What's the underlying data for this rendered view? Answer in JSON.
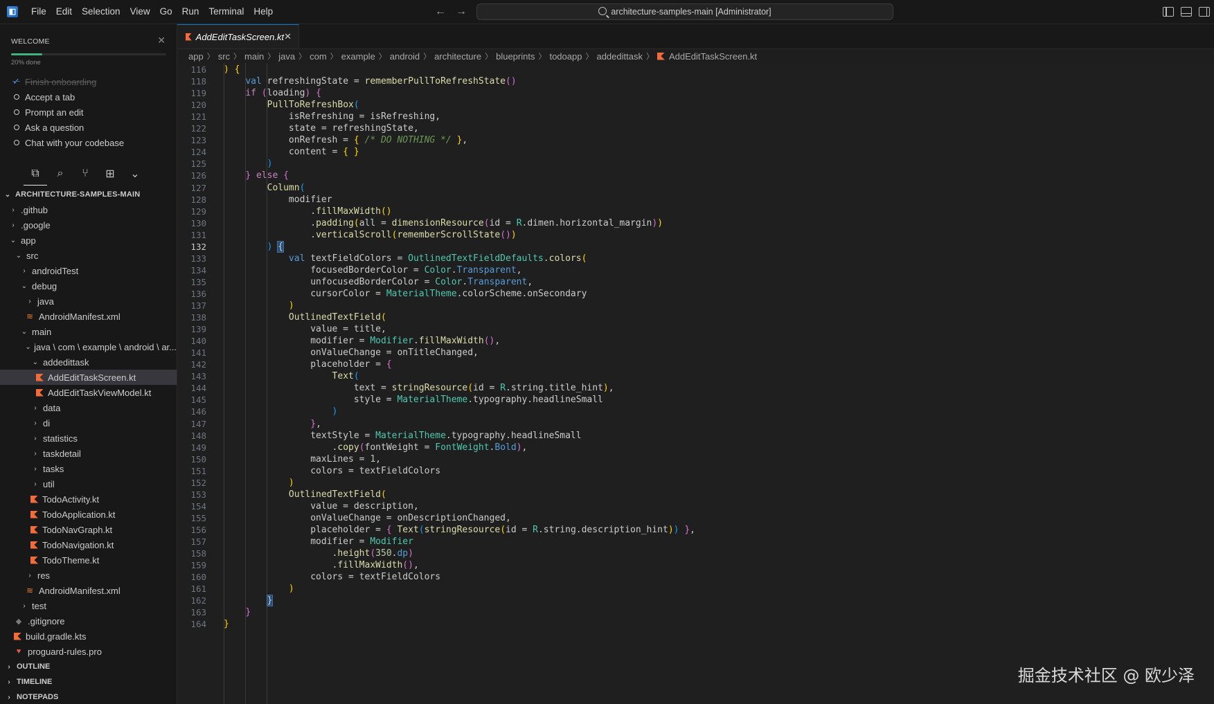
{
  "titlebar": {
    "menu": [
      "File",
      "Edit",
      "Selection",
      "View",
      "Go",
      "Run",
      "Terminal",
      "Help"
    ],
    "search_text": "architecture-samples-main [Administrator]"
  },
  "welcome": {
    "title": "WELCOME",
    "progress_fraction": 0.2,
    "progress_text": "20% done",
    "items": [
      {
        "label": "Finish onboarding",
        "done": true
      },
      {
        "label": "Accept a tab",
        "done": false
      },
      {
        "label": "Prompt an edit",
        "done": false
      },
      {
        "label": "Ask a question",
        "done": false
      },
      {
        "label": "Chat with your codebase",
        "done": false
      }
    ]
  },
  "explorer": {
    "root": "ARCHITECTURE-SAMPLES-MAIN",
    "tree": [
      {
        "label": ".github",
        "depth": 1,
        "type": "folder",
        "open": false
      },
      {
        "label": ".google",
        "depth": 1,
        "type": "folder",
        "open": false
      },
      {
        "label": "app",
        "depth": 1,
        "type": "folder",
        "open": true
      },
      {
        "label": "src",
        "depth": 2,
        "type": "folder",
        "open": true
      },
      {
        "label": "androidTest",
        "depth": 3,
        "type": "folder",
        "open": false
      },
      {
        "label": "debug",
        "depth": 3,
        "type": "folder",
        "open": true
      },
      {
        "label": "java",
        "depth": 4,
        "type": "folder",
        "open": false
      },
      {
        "label": "AndroidManifest.xml",
        "depth": 4,
        "type": "xml"
      },
      {
        "label": "main",
        "depth": 3,
        "type": "folder",
        "open": true
      },
      {
        "label": "java \\ com \\ example \\ android \\ ar...",
        "depth": 4,
        "type": "folder",
        "open": true
      },
      {
        "label": "addedittask",
        "depth": 5,
        "type": "folder",
        "open": true
      },
      {
        "label": "AddEditTaskScreen.kt",
        "depth": 6,
        "type": "kt",
        "selected": true
      },
      {
        "label": "AddEditTaskViewModel.kt",
        "depth": 6,
        "type": "kt"
      },
      {
        "label": "data",
        "depth": 5,
        "type": "folder",
        "open": false
      },
      {
        "label": "di",
        "depth": 5,
        "type": "folder",
        "open": false
      },
      {
        "label": "statistics",
        "depth": 5,
        "type": "folder",
        "open": false
      },
      {
        "label": "taskdetail",
        "depth": 5,
        "type": "folder",
        "open": false
      },
      {
        "label": "tasks",
        "depth": 5,
        "type": "folder",
        "open": false
      },
      {
        "label": "util",
        "depth": 5,
        "type": "folder",
        "open": false
      },
      {
        "label": "TodoActivity.kt",
        "depth": 5,
        "type": "kt"
      },
      {
        "label": "TodoApplication.kt",
        "depth": 5,
        "type": "kt"
      },
      {
        "label": "TodoNavGraph.kt",
        "depth": 5,
        "type": "kt"
      },
      {
        "label": "TodoNavigation.kt",
        "depth": 5,
        "type": "kt"
      },
      {
        "label": "TodoTheme.kt",
        "depth": 5,
        "type": "kt"
      },
      {
        "label": "res",
        "depth": 4,
        "type": "folder",
        "open": false
      },
      {
        "label": "AndroidManifest.xml",
        "depth": 4,
        "type": "xml"
      },
      {
        "label": "test",
        "depth": 3,
        "type": "folder",
        "open": false
      },
      {
        "label": ".gitignore",
        "depth": 2,
        "type": "git"
      },
      {
        "label": "build.gradle.kts",
        "depth": 2,
        "type": "gradle"
      },
      {
        "label": "proguard-rules.pro",
        "depth": 2,
        "type": "pro"
      }
    ],
    "sections": [
      "OUTLINE",
      "TIMELINE",
      "NOTEPADS"
    ]
  },
  "editor": {
    "tab": "AddEditTaskScreen.kt",
    "breadcrumb": [
      "app",
      "src",
      "main",
      "java",
      "com",
      "example",
      "android",
      "architecture",
      "blueprints",
      "todoapp",
      "addedittask",
      "AddEditTaskScreen.kt"
    ],
    "active_line": 132,
    "lines": [
      {
        "n": 116,
        "segs": [
          [
            "p1",
            ") {"
          ]
        ]
      },
      {
        "n": 118,
        "segs": [
          [
            "",
            "    "
          ],
          [
            "k",
            "val"
          ],
          [
            "",
            " refreshingState = "
          ],
          [
            "f",
            "rememberPullToRefreshState"
          ],
          [
            "p2",
            "()"
          ]
        ]
      },
      {
        "n": 119,
        "segs": [
          [
            "",
            "    "
          ],
          [
            "kw",
            "if"
          ],
          [
            "",
            " "
          ],
          [
            "p2",
            "("
          ],
          [
            "",
            "loading"
          ],
          [
            "p2",
            ")"
          ],
          [
            "",
            " "
          ],
          [
            "p2",
            "{"
          ]
        ]
      },
      {
        "n": 120,
        "segs": [
          [
            "",
            "        "
          ],
          [
            "f",
            "PullToRefreshBox"
          ],
          [
            "p3",
            "("
          ]
        ]
      },
      {
        "n": 121,
        "segs": [
          [
            "",
            "            isRefreshing = isRefreshing,"
          ]
        ]
      },
      {
        "n": 122,
        "segs": [
          [
            "",
            "            state = refreshingState,"
          ]
        ]
      },
      {
        "n": 123,
        "segs": [
          [
            "",
            "            onRefresh = "
          ],
          [
            "p1",
            "{"
          ],
          [
            "",
            " "
          ],
          [
            "c",
            "/* DO NOTHING */"
          ],
          [
            "",
            " "
          ],
          [
            "p1",
            "}"
          ],
          [
            "",
            ","
          ]
        ]
      },
      {
        "n": 124,
        "segs": [
          [
            "",
            "            content = "
          ],
          [
            "p1",
            "{"
          ],
          [
            "",
            " "
          ],
          [
            "p1",
            "}"
          ]
        ]
      },
      {
        "n": 125,
        "segs": [
          [
            "",
            "        "
          ],
          [
            "p3",
            ")"
          ]
        ]
      },
      {
        "n": 126,
        "segs": [
          [
            "",
            "    "
          ],
          [
            "p2",
            "}"
          ],
          [
            "",
            " "
          ],
          [
            "kw",
            "else"
          ],
          [
            "",
            " "
          ],
          [
            "p2",
            "{"
          ]
        ]
      },
      {
        "n": 127,
        "segs": [
          [
            "",
            "        "
          ],
          [
            "f",
            "Column"
          ],
          [
            "p3",
            "("
          ]
        ]
      },
      {
        "n": 128,
        "segs": [
          [
            "",
            "            modifier"
          ]
        ]
      },
      {
        "n": 129,
        "segs": [
          [
            "",
            "                ."
          ],
          [
            "f",
            "fillMaxWidth"
          ],
          [
            "p1",
            "()"
          ]
        ]
      },
      {
        "n": 130,
        "segs": [
          [
            "",
            "                ."
          ],
          [
            "f",
            "padding"
          ],
          [
            "p1",
            "("
          ],
          [
            "",
            "all = "
          ],
          [
            "f",
            "dimensionResource"
          ],
          [
            "p2",
            "("
          ],
          [
            "",
            "id = "
          ],
          [
            "t",
            "R"
          ],
          [
            "",
            ".dimen.horizontal_margin"
          ],
          [
            "p2",
            ")"
          ],
          [
            "p1",
            ")"
          ]
        ]
      },
      {
        "n": 131,
        "segs": [
          [
            "",
            "                ."
          ],
          [
            "f",
            "verticalScroll"
          ],
          [
            "p1",
            "("
          ],
          [
            "f",
            "rememberScrollState"
          ],
          [
            "p2",
            "()"
          ],
          [
            "p1",
            ")"
          ]
        ]
      },
      {
        "n": 132,
        "segs": [
          [
            "",
            "        "
          ],
          [
            "p3",
            ")"
          ],
          [
            "",
            " "
          ],
          [
            "hl",
            "{"
          ]
        ]
      },
      {
        "n": 133,
        "segs": [
          [
            "",
            "            "
          ],
          [
            "k",
            "val"
          ],
          [
            "",
            " textFieldColors = "
          ],
          [
            "t",
            "OutlinedTextFieldDefaults"
          ],
          [
            "",
            "."
          ],
          [
            "f",
            "colors"
          ],
          [
            "p1",
            "("
          ]
        ]
      },
      {
        "n": 134,
        "segs": [
          [
            "",
            "                focusedBorderColor = "
          ],
          [
            "t",
            "Color"
          ],
          [
            "",
            "."
          ],
          [
            "k",
            "Transparent"
          ],
          [
            "",
            ","
          ]
        ]
      },
      {
        "n": 135,
        "segs": [
          [
            "",
            "                unfocusedBorderColor = "
          ],
          [
            "t",
            "Color"
          ],
          [
            "",
            "."
          ],
          [
            "k",
            "Transparent"
          ],
          [
            "",
            ","
          ]
        ]
      },
      {
        "n": 136,
        "segs": [
          [
            "",
            "                cursorColor = "
          ],
          [
            "t",
            "MaterialTheme"
          ],
          [
            "",
            ".colorScheme.onSecondary"
          ]
        ]
      },
      {
        "n": 137,
        "segs": [
          [
            "",
            "            "
          ],
          [
            "p1",
            ")"
          ]
        ]
      },
      {
        "n": 138,
        "segs": [
          [
            "",
            "            "
          ],
          [
            "f",
            "OutlinedTextField"
          ],
          [
            "p1",
            "("
          ]
        ]
      },
      {
        "n": 139,
        "segs": [
          [
            "",
            "                value = title,"
          ]
        ]
      },
      {
        "n": 140,
        "segs": [
          [
            "",
            "                modifier = "
          ],
          [
            "t",
            "Modifier"
          ],
          [
            "",
            "."
          ],
          [
            "f",
            "fillMaxWidth"
          ],
          [
            "p2",
            "()"
          ],
          [
            "",
            ","
          ]
        ]
      },
      {
        "n": 141,
        "segs": [
          [
            "",
            "                onValueChange = onTitleChanged,"
          ]
        ]
      },
      {
        "n": 142,
        "segs": [
          [
            "",
            "                placeholder = "
          ],
          [
            "p2",
            "{"
          ]
        ]
      },
      {
        "n": 143,
        "segs": [
          [
            "",
            "                    "
          ],
          [
            "f",
            "Text"
          ],
          [
            "p3",
            "("
          ]
        ]
      },
      {
        "n": 144,
        "segs": [
          [
            "",
            "                        text = "
          ],
          [
            "f",
            "stringResource"
          ],
          [
            "p1",
            "("
          ],
          [
            "",
            "id = "
          ],
          [
            "t",
            "R"
          ],
          [
            "",
            ".string.title_hint"
          ],
          [
            "p1",
            ")"
          ],
          [
            "",
            ","
          ]
        ]
      },
      {
        "n": 145,
        "segs": [
          [
            "",
            "                        style = "
          ],
          [
            "t",
            "MaterialTheme"
          ],
          [
            "",
            ".typography.headlineSmall"
          ]
        ]
      },
      {
        "n": 146,
        "segs": [
          [
            "",
            "                    "
          ],
          [
            "p3",
            ")"
          ]
        ]
      },
      {
        "n": 147,
        "segs": [
          [
            "",
            "                "
          ],
          [
            "p2",
            "}"
          ],
          [
            "",
            ","
          ]
        ]
      },
      {
        "n": 148,
        "segs": [
          [
            "",
            "                textStyle = "
          ],
          [
            "t",
            "MaterialTheme"
          ],
          [
            "",
            ".typography.headlineSmall"
          ]
        ]
      },
      {
        "n": 149,
        "segs": [
          [
            "",
            "                    ."
          ],
          [
            "f",
            "copy"
          ],
          [
            "p2",
            "("
          ],
          [
            "",
            "fontWeight = "
          ],
          [
            "t",
            "FontWeight"
          ],
          [
            "",
            "."
          ],
          [
            "k",
            "Bold"
          ],
          [
            "p2",
            ")"
          ],
          [
            "",
            ","
          ]
        ]
      },
      {
        "n": 150,
        "segs": [
          [
            "",
            "                maxLines = "
          ],
          [
            "n",
            "1"
          ],
          [
            "",
            ","
          ]
        ]
      },
      {
        "n": 151,
        "segs": [
          [
            "",
            "                colors = textFieldColors"
          ]
        ]
      },
      {
        "n": 152,
        "segs": [
          [
            "",
            "            "
          ],
          [
            "p1",
            ")"
          ]
        ]
      },
      {
        "n": 153,
        "segs": [
          [
            "",
            "            "
          ],
          [
            "f",
            "OutlinedTextField"
          ],
          [
            "p1",
            "("
          ]
        ]
      },
      {
        "n": 154,
        "segs": [
          [
            "",
            "                value = description,"
          ]
        ]
      },
      {
        "n": 155,
        "segs": [
          [
            "",
            "                onValueChange = onDescriptionChanged,"
          ]
        ]
      },
      {
        "n": 156,
        "segs": [
          [
            "",
            "                placeholder = "
          ],
          [
            "p2",
            "{"
          ],
          [
            "",
            " "
          ],
          [
            "f",
            "Text"
          ],
          [
            "p3",
            "("
          ],
          [
            "f",
            "stringResource"
          ],
          [
            "p1",
            "("
          ],
          [
            "",
            "id = "
          ],
          [
            "t",
            "R"
          ],
          [
            "",
            ".string.description_hint"
          ],
          [
            "p1",
            ")"
          ],
          [
            "p3",
            ")"
          ],
          [
            "",
            " "
          ],
          [
            "p2",
            "}"
          ],
          [
            "",
            ","
          ]
        ]
      },
      {
        "n": 157,
        "segs": [
          [
            "",
            "                modifier = "
          ],
          [
            "t",
            "Modifier"
          ]
        ]
      },
      {
        "n": 158,
        "segs": [
          [
            "",
            "                    ."
          ],
          [
            "f",
            "height"
          ],
          [
            "p2",
            "("
          ],
          [
            "n",
            "350"
          ],
          [
            "",
            "."
          ],
          [
            "k",
            "dp"
          ],
          [
            "p2",
            ")"
          ]
        ]
      },
      {
        "n": 159,
        "segs": [
          [
            "",
            "                    ."
          ],
          [
            "f",
            "fillMaxWidth"
          ],
          [
            "p2",
            "()"
          ],
          [
            "",
            ","
          ]
        ]
      },
      {
        "n": 160,
        "segs": [
          [
            "",
            "                colors = textFieldColors"
          ]
        ]
      },
      {
        "n": 161,
        "segs": [
          [
            "",
            "            "
          ],
          [
            "p1",
            ")"
          ]
        ]
      },
      {
        "n": 162,
        "segs": [
          [
            "",
            "        "
          ],
          [
            "hl",
            "}"
          ]
        ]
      },
      {
        "n": 163,
        "segs": [
          [
            "",
            "    "
          ],
          [
            "p2",
            "}"
          ]
        ]
      },
      {
        "n": 164,
        "segs": [
          [
            "p1",
            "}"
          ]
        ]
      }
    ]
  },
  "watermark": "掘金技术社区 @ 欧少泽"
}
